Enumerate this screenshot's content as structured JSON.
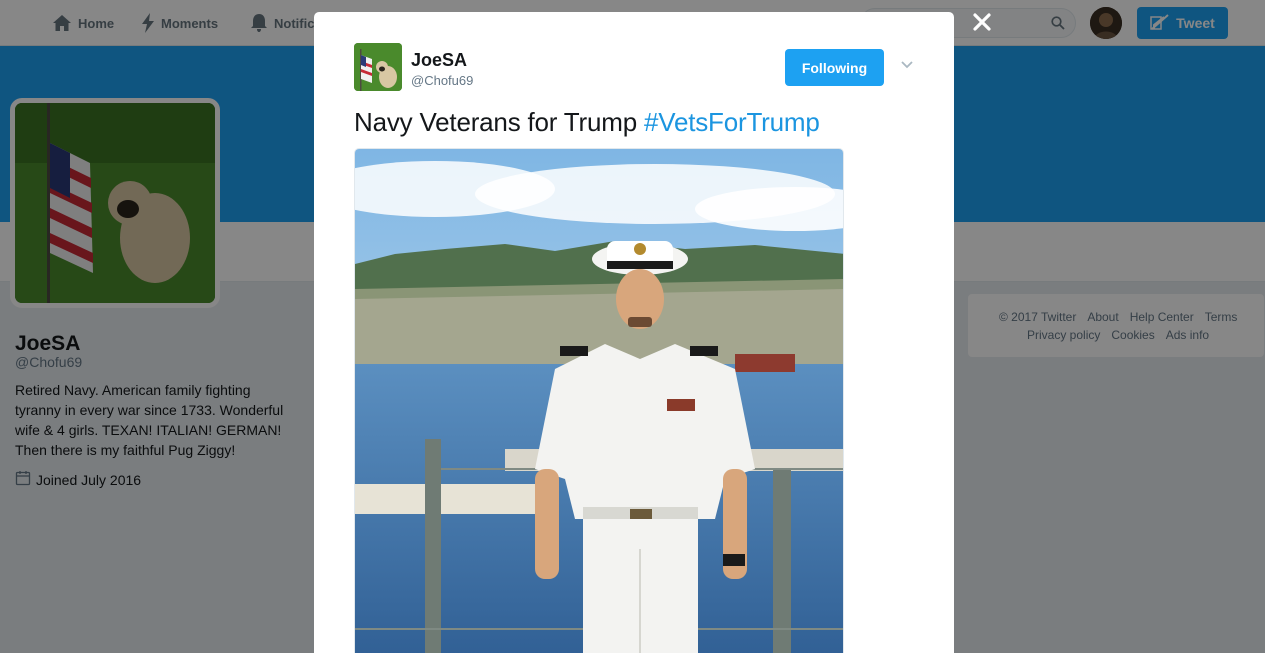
{
  "nav": {
    "home_label": "Home",
    "moments_label": "Moments",
    "notifications_label": "Notifica",
    "tweet_label": "Tweet",
    "search_placeholder": ""
  },
  "profile": {
    "name": "JoeSA",
    "handle": "@Chofu69",
    "bio": "Retired Navy. American family fighting tyranny in every war since 1733. Wonderful wife & 4 girls. TEXAN! ITALIAN! GERMAN! Then there is my faithful Pug Ziggy!",
    "joined": "Joined July 2016"
  },
  "footer": {
    "links_row1": [
      "© 2017 Twitter",
      "About",
      "Help Center",
      "Terms"
    ],
    "links_row2": [
      "Privacy policy",
      "Cookies",
      "Ads info"
    ]
  },
  "modal": {
    "author_name": "JoeSA",
    "author_handle": "@Chofu69",
    "follow_label": "Following",
    "tweet_text": "Navy Veterans for Trump ",
    "hashtag": "#VetsForTrump"
  },
  "colors": {
    "brand": "#1da1f2",
    "hashtag": "#1b95e0",
    "page_bg": "#e6ecf0"
  },
  "icons": {
    "home": "home-icon",
    "moments": "lightning-icon",
    "notifications": "bell-icon",
    "search": "search-icon",
    "tweet": "quill-icon",
    "calendar": "calendar-icon",
    "close": "close-icon",
    "caret": "chevron-down-icon"
  }
}
